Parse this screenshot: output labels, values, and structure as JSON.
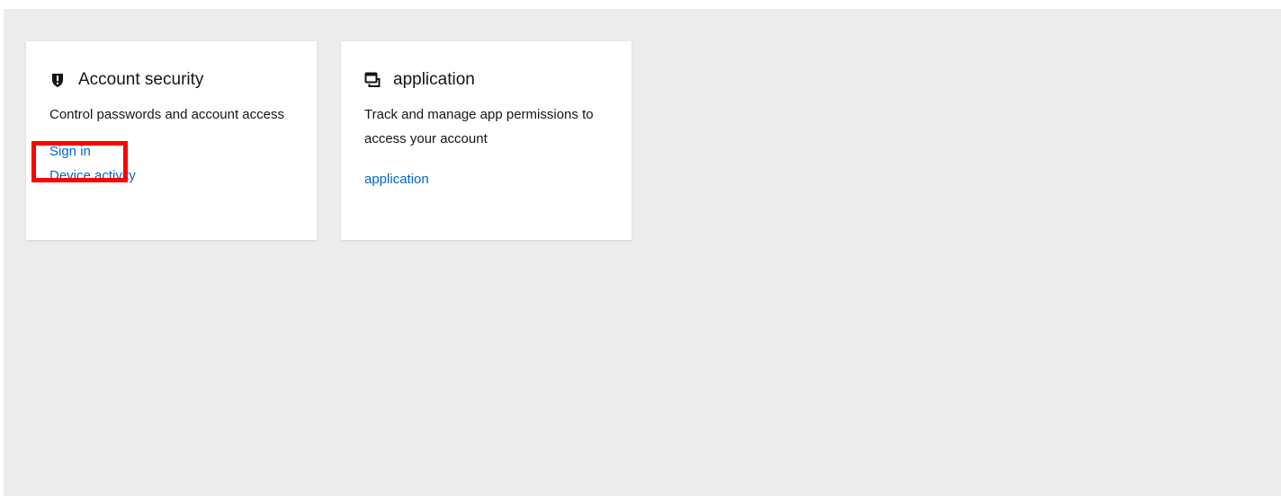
{
  "cards": [
    {
      "title": "Account security",
      "icon": "shield-icon",
      "description": "Control passwords and account access",
      "links": [
        {
          "label": "Sign in"
        },
        {
          "label": "Device activity"
        }
      ]
    },
    {
      "title": "application",
      "icon": "application-window-icon",
      "description": "Track and manage app permissions to access your account",
      "links": [
        {
          "label": "application"
        }
      ]
    }
  ],
  "highlight": {
    "target": "Sign in",
    "color": "#ff0000"
  },
  "colors": {
    "background": "#ececec",
    "card": "#ffffff",
    "link": "#0066cc",
    "text": "#151515"
  }
}
